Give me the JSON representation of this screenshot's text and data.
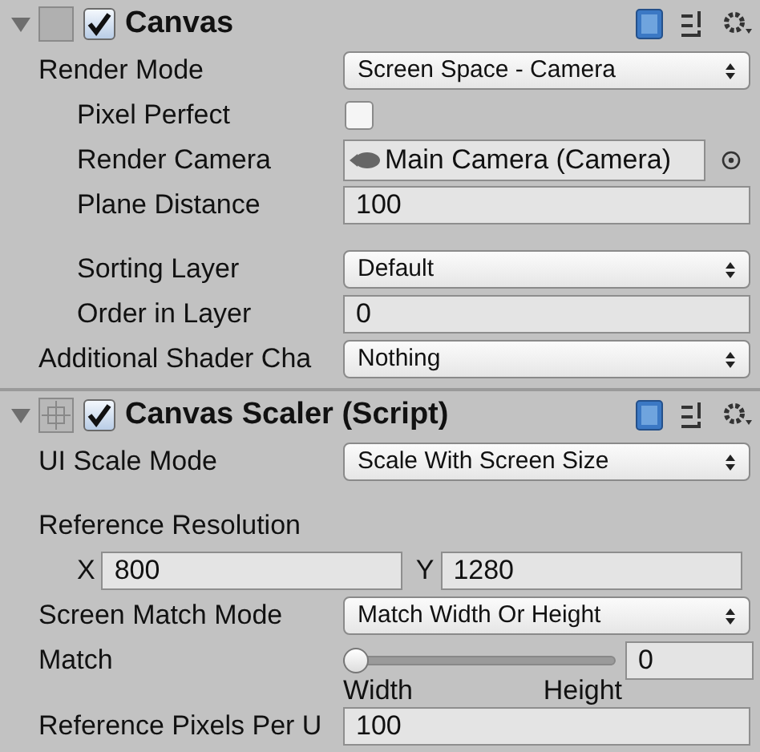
{
  "components": [
    {
      "title": "Canvas",
      "expanded": true,
      "enabled": true,
      "properties": [
        {
          "kind": "dropdown",
          "label": "Render Mode",
          "value": "Screen Space - Camera",
          "children": [
            {
              "kind": "checkbox",
              "label": "Pixel Perfect",
              "checked": false
            },
            {
              "kind": "object",
              "label": "Render Camera",
              "value": "Main Camera (Camera)"
            },
            {
              "kind": "number",
              "label": "Plane Distance",
              "value": "100"
            },
            {
              "kind": "spacer"
            },
            {
              "kind": "dropdown",
              "label": "Sorting Layer",
              "value": "Default"
            },
            {
              "kind": "number",
              "label": "Order in Layer",
              "value": "0"
            }
          ]
        },
        {
          "kind": "dropdown",
          "label": "Additional Shader Cha",
          "value": "Nothing"
        }
      ]
    },
    {
      "title": "Canvas Scaler (Script)",
      "expanded": true,
      "enabled": true,
      "properties": [
        {
          "kind": "dropdown",
          "label": "UI Scale Mode",
          "value": "Scale With Screen Size"
        },
        {
          "kind": "spacer"
        },
        {
          "kind": "heading",
          "label": "Reference Resolution",
          "children": [
            {
              "kind": "vector",
              "x_label": "X",
              "x_value": "800",
              "y_label": "Y",
              "y_value": "1280"
            }
          ]
        },
        {
          "kind": "dropdown",
          "label": "Screen Match Mode",
          "value": "Match Width Or Height"
        },
        {
          "kind": "slider",
          "label": "Match",
          "value": "0",
          "level": 0,
          "min_label": "Width",
          "max_label": "Height"
        },
        {
          "kind": "number",
          "label": "Reference Pixels Per U",
          "value": "100"
        }
      ]
    }
  ]
}
